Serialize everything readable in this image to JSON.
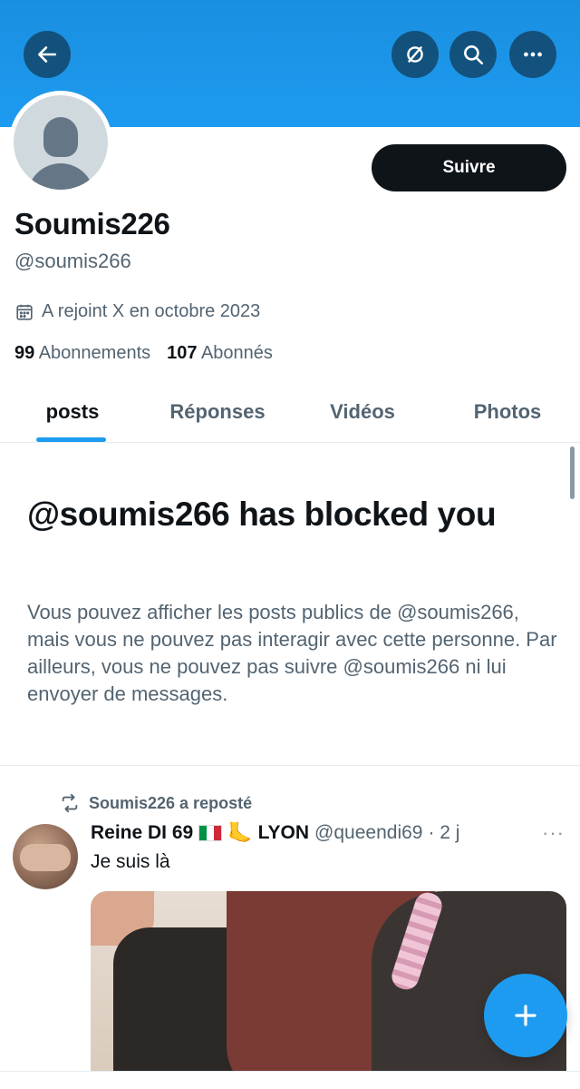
{
  "header": {
    "back_icon": "back-arrow-icon",
    "actions": [
      "no-sync-icon",
      "search-icon",
      "more-icon"
    ],
    "banner_color": "#1d9bf0"
  },
  "profile": {
    "display_name": "Soumis226",
    "handle": "@soumis266",
    "joined": "A rejoint X en octobre 2023",
    "following_count": "99",
    "following_label": "Abonnements",
    "followers_count": "107",
    "followers_label": "Abonnés",
    "follow_button": "Suivre"
  },
  "tabs": [
    {
      "label": "posts",
      "active": true
    },
    {
      "label": "Réponses",
      "active": false
    },
    {
      "label": "Vidéos",
      "active": false
    },
    {
      "label": "Photos",
      "active": false
    }
  ],
  "blocked": {
    "title": "@soumis266 has blocked you",
    "message": "Vous pouvez afficher les posts publics de @soumis266, mais vous ne pouvez pas interagir avec cette personne. Par ailleurs, vous ne pouvez pas suivre @soumis266 ni lui envoyer de messages."
  },
  "post": {
    "repost_label": "Soumis226 a reposté",
    "author_name": "Reine DI 69",
    "author_location": "LYON",
    "author_handle": "@queendi69",
    "age": "· 2 j",
    "text": "Je suis là",
    "more": "···"
  },
  "fab": {
    "icon": "plus-icon",
    "color": "#1d9bf0"
  }
}
